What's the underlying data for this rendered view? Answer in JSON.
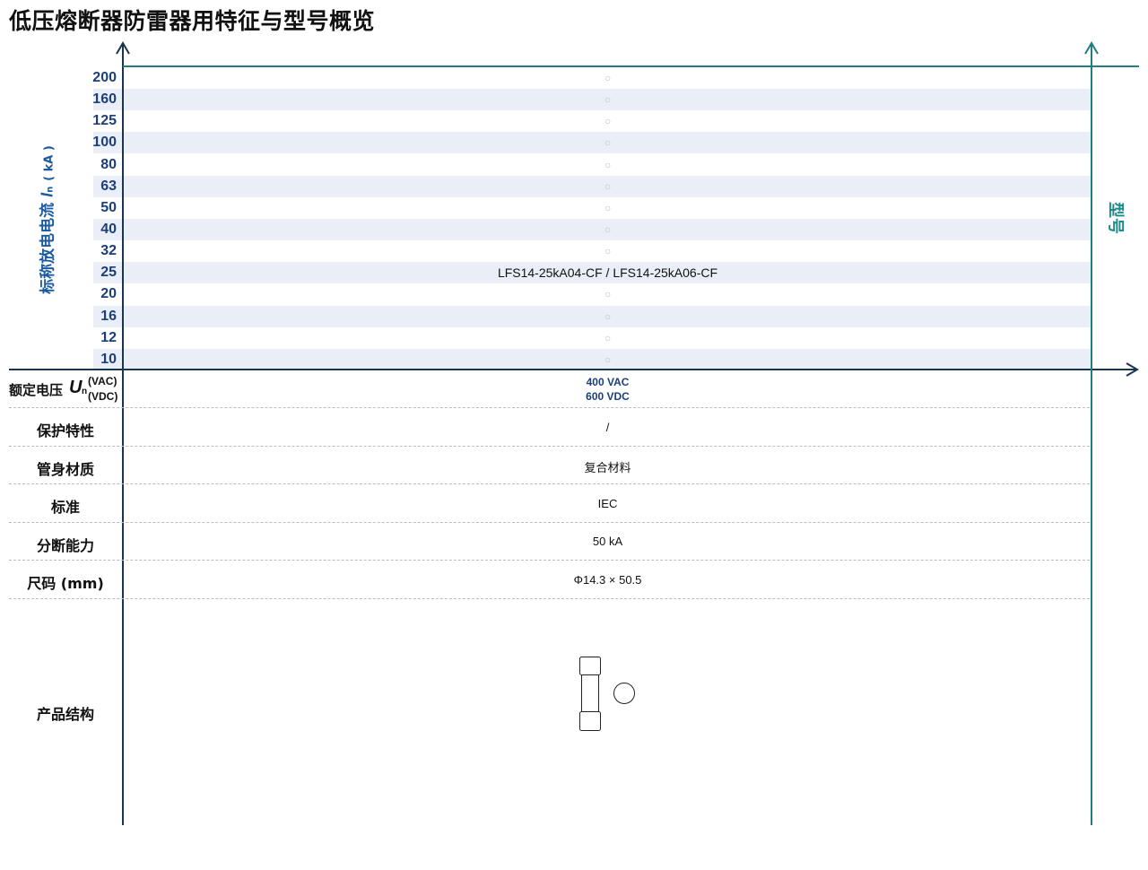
{
  "title": "低压熔断器防雷器用特征与型号概览",
  "y_axis": {
    "label": "标称放电电流",
    "symbol": "I",
    "subscript": "n",
    "unit": "( kA )"
  },
  "model_axis_label": "型号",
  "rows": [
    {
      "current": "200",
      "model": "○",
      "empty": true
    },
    {
      "current": "160",
      "model": "○",
      "empty": true
    },
    {
      "current": "125",
      "model": "○",
      "empty": true
    },
    {
      "current": "100",
      "model": "○",
      "empty": true
    },
    {
      "current": "80",
      "model": "○",
      "empty": true
    },
    {
      "current": "63",
      "model": "○",
      "empty": true
    },
    {
      "current": "50",
      "model": "○",
      "empty": true
    },
    {
      "current": "40",
      "model": "○",
      "empty": true
    },
    {
      "current": "32",
      "model": "○",
      "empty": true
    },
    {
      "current": "25",
      "model": "LFS14-25kA04-CF / LFS14-25kA06-CF",
      "empty": false
    },
    {
      "current": "20",
      "model": "○",
      "empty": true
    },
    {
      "current": "16",
      "model": "○",
      "empty": true
    },
    {
      "current": "12",
      "model": "○",
      "empty": true
    },
    {
      "current": "10",
      "model": "○",
      "empty": true
    }
  ],
  "rated_voltage": {
    "label": "额定电压",
    "symbol": "U",
    "subscript": "n",
    "unit_vac": "(VAC)",
    "unit_vdc": "(VDC)",
    "vac": "400 VAC",
    "vdc": "600 VDC"
  },
  "props": [
    {
      "label": "保护特性",
      "value": "/"
    },
    {
      "label": "管身材质",
      "value": "复合材料"
    },
    {
      "label": "标准",
      "value": "IEC"
    },
    {
      "label": "分断能力",
      "value": "50 kA"
    },
    {
      "label": "尺码 (mm)",
      "value": "Φ14.3 × 50.5"
    }
  ],
  "structure": {
    "label": "产品结构",
    "icon": "fuse-icon"
  },
  "colors": {
    "axis_navy": "#1a3550",
    "axis_teal": "#1f7f7f",
    "tick_blue": "#1c3f78",
    "band": "#eaeef6"
  }
}
